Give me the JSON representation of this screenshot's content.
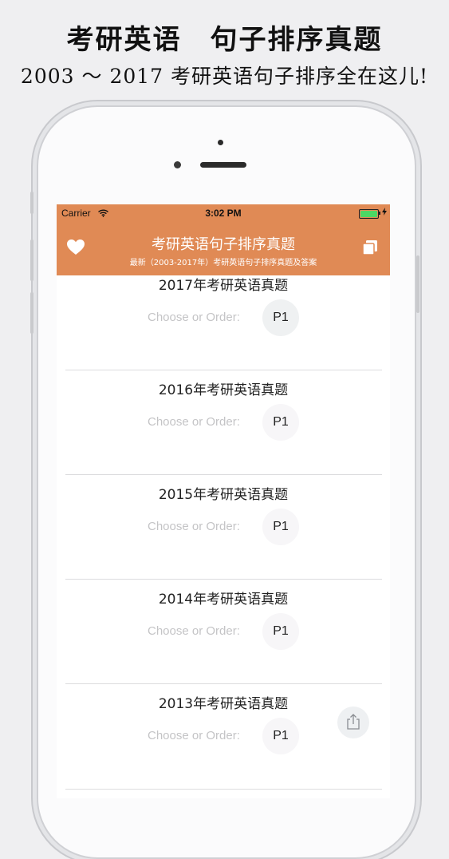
{
  "promo": {
    "title": "考研英语　句子排序真题",
    "subtitle": "2003 ～ 2017 考研英语句子排序全在这儿!"
  },
  "status_bar": {
    "carrier": "Carrier",
    "time": "3:02 PM",
    "battery_level": 1.0,
    "battery_color": "#4cd964",
    "wifi_icon": "wifi-icon",
    "charging_icon": "bolt-icon"
  },
  "nav": {
    "title": "考研英语句子排序真题",
    "subtitle": "最新（2003-2017年）考研英语句子排序真题及答案",
    "left_icon": "heart-icon",
    "right_icon": "copy-icon",
    "background_color": "#e08a55"
  },
  "list": {
    "placeholder": "Choose or Order:",
    "rows": [
      {
        "title": "2017年考研英语真题",
        "page": "P1"
      },
      {
        "title": "2016年考研英语真题",
        "page": "P1"
      },
      {
        "title": "2015年考研英语真题",
        "page": "P1"
      },
      {
        "title": "2014年考研英语真题",
        "page": "P1"
      },
      {
        "title": "2013年考研英语真题",
        "page": "P1"
      }
    ],
    "share_icon": "share-icon"
  }
}
